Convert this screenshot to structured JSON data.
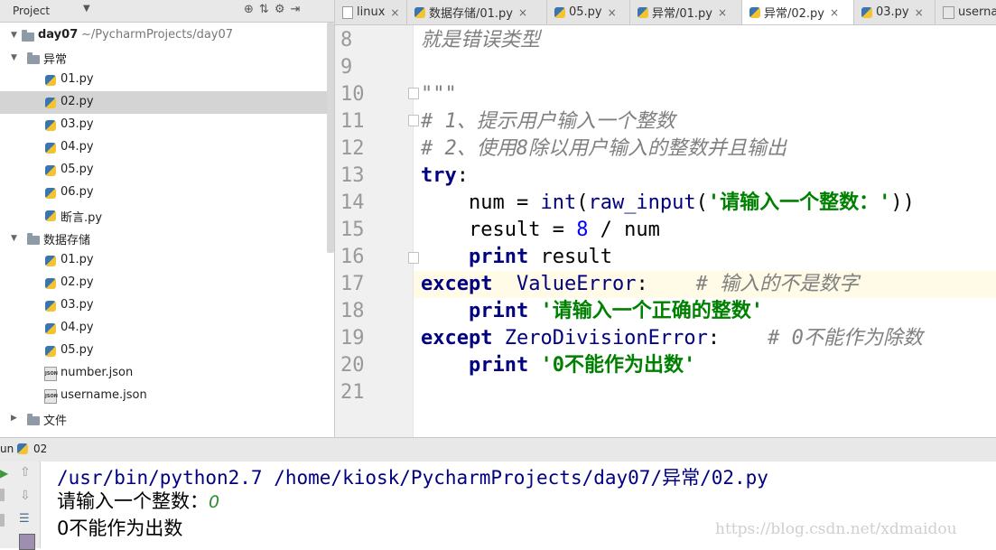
{
  "project_panel": {
    "title": "Project",
    "root_name": "day07",
    "root_path": "~/PycharmProjects/day07",
    "folder_yichang": "异常",
    "yichang_files": [
      "01.py",
      "02.py",
      "03.py",
      "04.py",
      "05.py",
      "06.py",
      "断言.py"
    ],
    "folder_shuju": "数据存储",
    "shuju_files": [
      "01.py",
      "02.py",
      "03.py",
      "04.py",
      "05.py",
      "number.json",
      "username.json"
    ],
    "folder_wenjian": "文件",
    "selected_file": "02.py"
  },
  "tabs": [
    {
      "label": "linux",
      "icon": "text-file-icon",
      "active": false
    },
    {
      "label": "数据存储/01.py",
      "icon": "python-file-icon",
      "active": false
    },
    {
      "label": "05.py",
      "icon": "python-file-icon",
      "active": false
    },
    {
      "label": "异常/01.py",
      "icon": "python-file-icon",
      "active": false
    },
    {
      "label": "异常/02.py",
      "icon": "python-file-icon",
      "active": true
    },
    {
      "label": "03.py",
      "icon": "python-file-icon",
      "active": false
    },
    {
      "label": "userna",
      "icon": "json-file-icon",
      "active": false
    }
  ],
  "editor": {
    "line_numbers": [
      "8",
      "9",
      "10",
      "11",
      "12",
      "13",
      "14",
      "15",
      "16",
      "17",
      "18",
      "19",
      "20",
      "21"
    ],
    "current_line": "17",
    "lines": {
      "l8": "就是错误类型",
      "l10": "\"\"\"",
      "l11": "# 1、提示用户输入一个整数",
      "l12": "# 2、使用8除以用户输入的整数并且输出",
      "l13_kw": "try",
      "l14_a": "    num = ",
      "l14_f1": "int",
      "l14_f2": "raw_input",
      "l14_s": "'请输入一个整数：'",
      "l15_a": "    result = ",
      "l15_n": "8",
      "l15_b": " / num",
      "l16_kw": "print",
      "l16_b": " result",
      "l17_kw": "except",
      "l17_err": "ValueError",
      "l17_c": "# 输入的不是数字",
      "l18_kw": "print",
      "l18_s": "'请输入一个正确的整数'",
      "l19_kw": "except",
      "l19_err": "ZeroDivisionError",
      "l19_c": "# 0不能作为除数",
      "l20_kw": "print",
      "l20_s": "'0不能作为出数'"
    }
  },
  "run": {
    "label": "un",
    "config": "02",
    "command": "/usr/bin/python2.7 /home/kiosk/PycharmProjects/day07/异常/02.py",
    "prompt": "请输入一个整数：",
    "input": "0",
    "output": "0不能作为出数",
    "watermark": "https://blog.csdn.net/xdmaidou"
  },
  "colors": {
    "keyword": "#000080",
    "string": "#008000",
    "number": "#0000ff",
    "comment": "#808080"
  }
}
